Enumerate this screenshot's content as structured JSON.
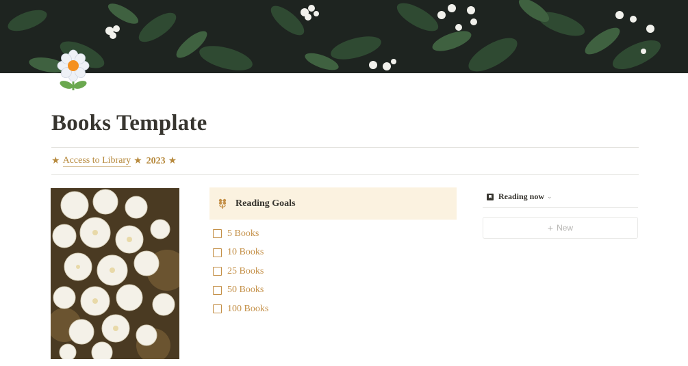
{
  "page": {
    "title": "Books Template"
  },
  "header": {
    "star_left": "★",
    "library_link": "Access to Library",
    "star_mid": "★",
    "year": "2023",
    "star_right": "★"
  },
  "goals": {
    "title": "Reading Goals",
    "items": [
      {
        "label": "5 Books",
        "checked": false
      },
      {
        "label": "10 Books",
        "checked": false
      },
      {
        "label": "25 Books",
        "checked": false
      },
      {
        "label": "50 Books",
        "checked": false
      },
      {
        "label": "100 Books",
        "checked": false
      }
    ]
  },
  "database": {
    "view_name": "Reading now",
    "new_label": "New"
  },
  "colors": {
    "accent": "#c49048",
    "callout_bg": "#fbf2e0",
    "text": "#37352f"
  },
  "icons": {
    "page_icon": "daisy-flower-icon",
    "goals_icon": "flower-icon",
    "view_icon": "book-icon"
  }
}
